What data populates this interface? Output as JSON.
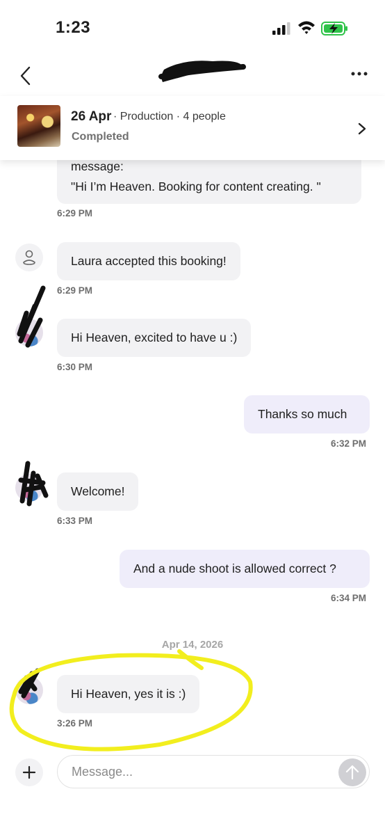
{
  "status_bar": {
    "time": "1:23"
  },
  "booking": {
    "date": "26 Apr",
    "meta": "· Production · 4 people",
    "status": "Completed"
  },
  "messages": {
    "m1": {
      "line1": "message:",
      "line2": "\"Hi I’m Heaven. Booking for content creating. \"",
      "time": "6:29 PM"
    },
    "m2": {
      "text": "Laura accepted this booking!",
      "time": "6:29 PM"
    },
    "m3": {
      "text": "Hi Heaven, excited to have u :)",
      "time": "6:30 PM"
    },
    "m4": {
      "text": "Thanks so much",
      "time": "6:32 PM"
    },
    "m5": {
      "text": "Welcome!",
      "time": "6:33 PM"
    },
    "m6": {
      "text": "And a nude shoot is allowed correct ?",
      "time": "6:34 PM"
    },
    "date_separator": "Apr 14, 2026",
    "m7": {
      "text": "Hi Heaven, yes it is :)",
      "time": "3:26 PM"
    }
  },
  "composer": {
    "placeholder": "Message..."
  },
  "colors": {
    "highlight": "#f2ee1e",
    "outgoing_bubble": "#efedfa",
    "incoming_bubble": "#f2f2f4"
  },
  "icons": [
    "signal-icon",
    "wifi-icon",
    "battery-icon",
    "back-icon",
    "more-icon",
    "chevron-right-icon",
    "user-icon",
    "plus-icon",
    "arrow-up-icon"
  ]
}
